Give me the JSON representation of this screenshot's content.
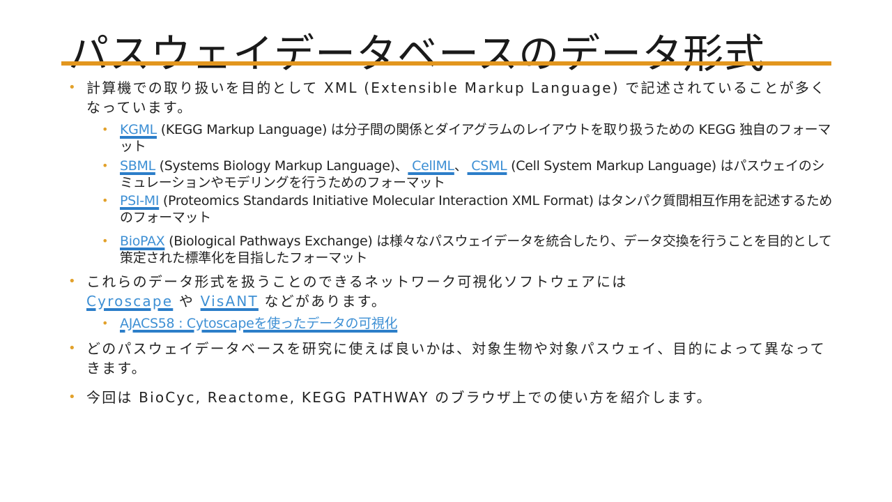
{
  "slide": {
    "title": "パスウェイデータベースのデータ形式",
    "accent_color": "#E2961E",
    "link_color": "#3D8FD4",
    "bullet1": {
      "text": "計算機での取り扱いを目的として XML (Extensible Markup Language) で記述されていることが多くなっています。",
      "sub": [
        {
          "link": "KGML",
          "text": " (KEGG Markup Language) は分子間の関係とダイアグラムのレイアウトを取り扱うための KEGG 独自のフォーマット"
        },
        {
          "link1": "SBML",
          "text1": " (Systems Biology Markup Language)、",
          "link2": " CellML",
          "sep": "、",
          "link3": " CSML",
          "text2": " (Cell System Markup Language) はパスウェイのシミュレーションやモデリングを行うためのフォーマット"
        },
        {
          "link": "PSI-MI",
          "text": " (Proteomics Standards Initiative Molecular Interaction XML Format) はタンパク質間相互作用を記述するためのフォーマット"
        },
        {
          "link": "BioPAX",
          "text": " (Biological Pathways Exchange) は様々なパスウェイデータを統合したり、データ交換を行うことを目的として策定された標準化を目指したフォーマット"
        }
      ]
    },
    "bullet2": {
      "text1": "これらのデータ形式を扱うことのできるネットワーク可視化ソフトウェアには",
      "link1": "Cyroscape",
      "text2": " や ",
      "link2": "VisANT",
      "text3": " などがあります。",
      "sub_link": "AJACS58 : Cytoscapeを使ったデータの可視化"
    },
    "bullet3": {
      "text": "どのパスウェイデータベースを研究に使えば良いかは、対象生物や対象パスウェイ、目的によって異なってきます。"
    },
    "bullet4": {
      "text": "今回は BioCyc, Reactome, KEGG PATHWAY のブラウザ上での使い方を紹介します。"
    }
  }
}
